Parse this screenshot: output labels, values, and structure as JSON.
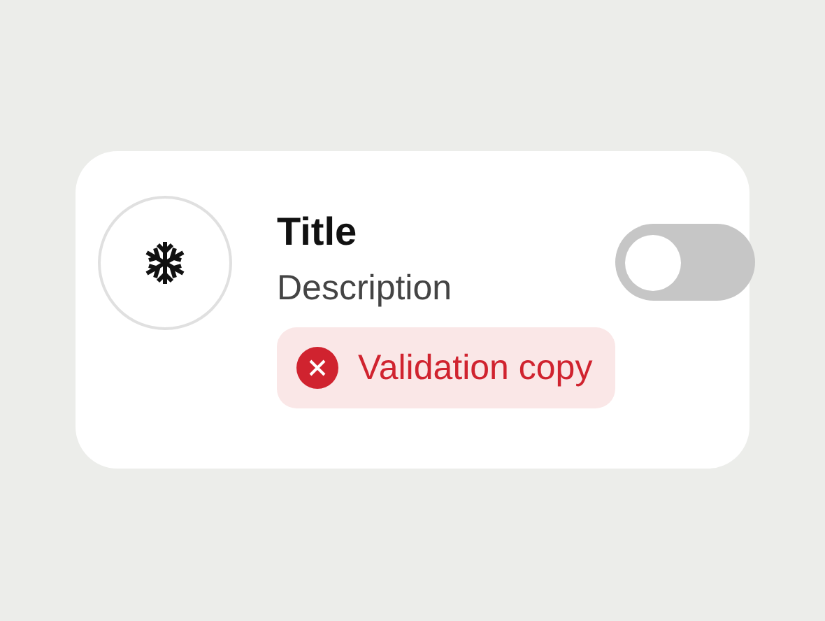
{
  "card": {
    "title": "Title",
    "description": "Description",
    "toggle": {
      "on": false
    },
    "validation": {
      "kind": "error",
      "message": "Validation copy"
    }
  }
}
